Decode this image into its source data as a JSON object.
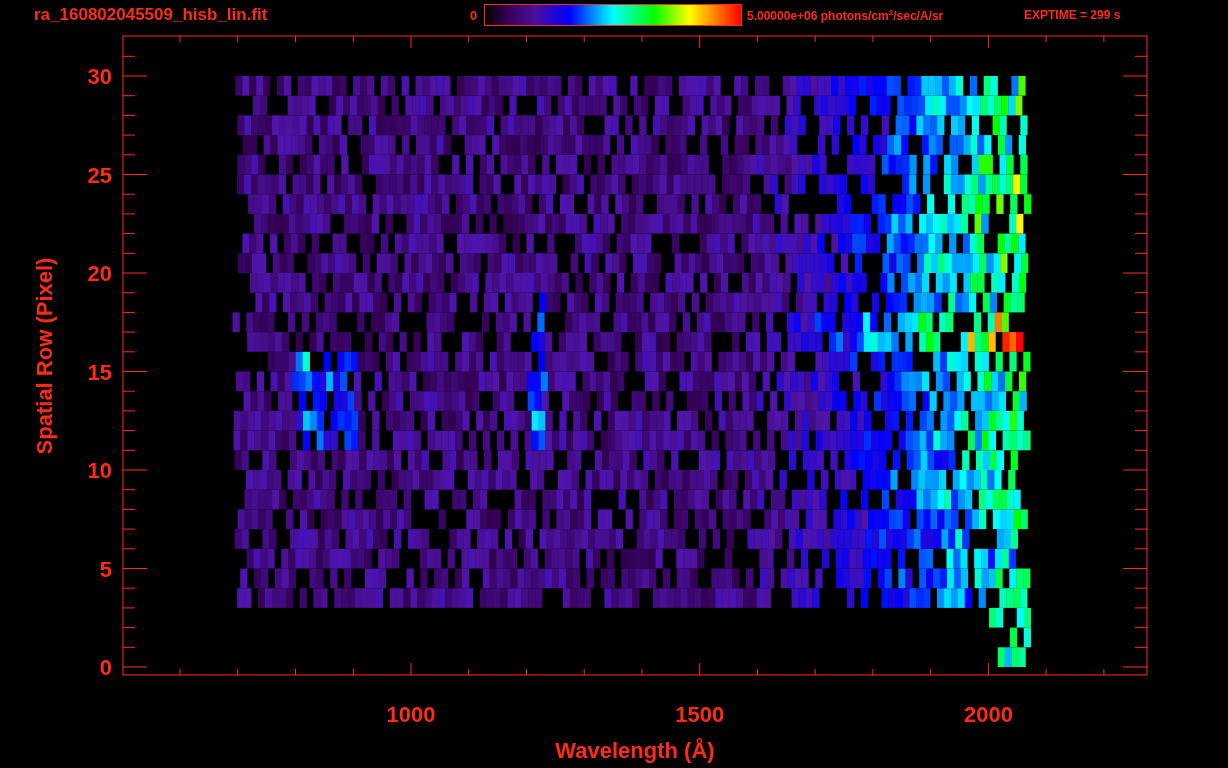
{
  "title": "ra_160802045509_hisb_lin.fit",
  "colorbar": {
    "min_label": "0",
    "max_label": "5.00000e+06 photons/cm$^{2}$/sec/A/sr"
  },
  "exposure": "EXPTIME = 299 s",
  "plot": {
    "xlabel": "Wavelength (Å)",
    "ylabel": "Spatial Row (Pixel)",
    "xtick_labels": [
      "1000",
      "1500",
      "2000"
    ],
    "ytick_labels": [
      "30",
      "25",
      "20",
      "15",
      "10",
      "5",
      "0"
    ]
  }
}
